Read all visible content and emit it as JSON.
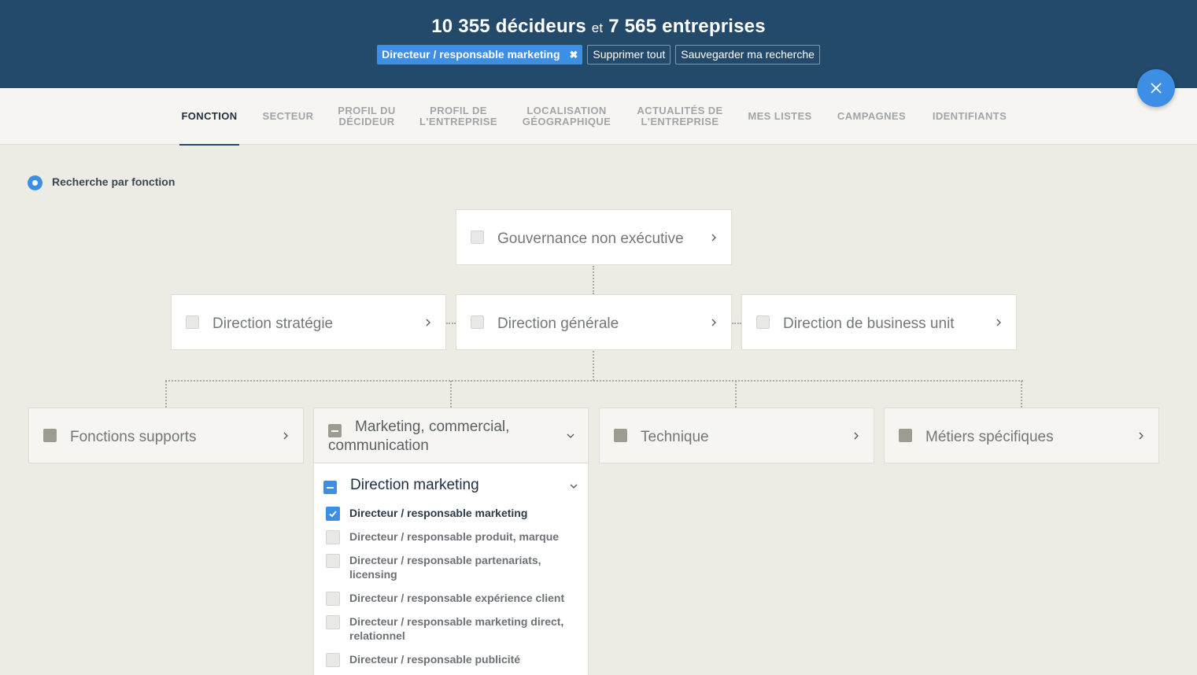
{
  "header": {
    "count_people": "10 355 décideurs",
    "connector": "et",
    "count_companies": "7 565 entreprises",
    "active_filter": "Directeur / responsable marketing",
    "remove_filter_icon": "✖",
    "clear_all": "Supprimer tout",
    "save_search": "Sauvegarder ma recherche"
  },
  "tabs": [
    {
      "label": "FONCTION",
      "active": true
    },
    {
      "label": "SECTEUR"
    },
    {
      "label": "PROFIL DU\nDÉCIDEUR"
    },
    {
      "label": "PROFIL DE\nL'ENTREPRISE"
    },
    {
      "label": "LOCALISATION\nGÉOGRAPHIQUE"
    },
    {
      "label": "ACTUALITÉS DE\nL'ENTREPRISE"
    },
    {
      "label": "MES LISTES"
    },
    {
      "label": "CAMPAGNES"
    },
    {
      "label": "IDENTIFIANTS"
    }
  ],
  "search_mode": {
    "label": "Recherche par fonction"
  },
  "tree": {
    "level1": {
      "label": "Gouvernance non exécutive"
    },
    "level2": [
      {
        "label": "Direction stratégie"
      },
      {
        "label": "Direction générale"
      },
      {
        "label": "Direction de business unit"
      }
    ],
    "level3": [
      {
        "label": "Fonctions supports"
      },
      {
        "label": "Marketing, commercial, communication",
        "line1": "Marketing, commercial,",
        "line2": "communication",
        "expanded": true
      },
      {
        "label": "Technique"
      },
      {
        "label": "Métiers spécifiques"
      }
    ]
  },
  "subgroup": {
    "title": "Direction marketing",
    "items": [
      {
        "label": "Directeur / responsable marketing",
        "checked": true
      },
      {
        "label": "Directeur / responsable produit, marque",
        "checked": false
      },
      {
        "label": "Directeur / responsable partenariats, licensing",
        "checked": false
      },
      {
        "label": "Directeur / responsable expérience client",
        "checked": false
      },
      {
        "label": "Directeur / responsable marketing direct, relationnel",
        "checked": false
      },
      {
        "label": "Directeur / responsable publicité",
        "checked": false
      }
    ]
  },
  "icons": {
    "close": "close-icon",
    "chevron_right": "chevron-right-icon",
    "chevron_down": "chevron-down-icon",
    "check": "check-icon"
  },
  "colors": {
    "header_bg": "#234a6b",
    "accent": "#3d8fe6",
    "page_bg": "#ecebe4"
  }
}
